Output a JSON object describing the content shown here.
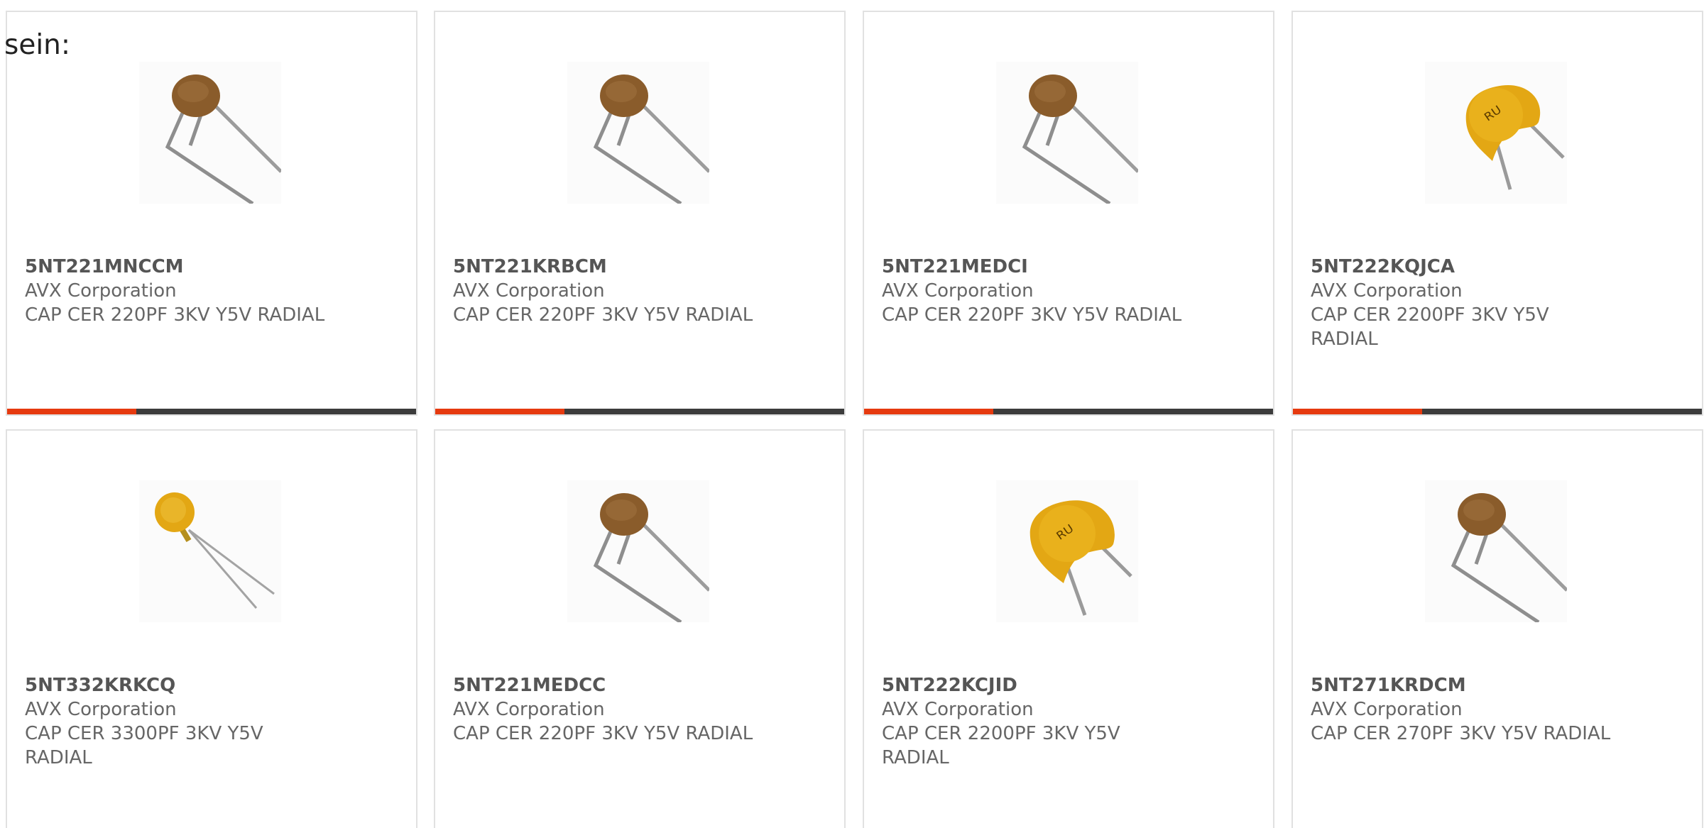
{
  "intro_text": "sein:",
  "colors": {
    "accent": "#e63a0f",
    "bar_dark": "#3c3c3c",
    "card_border": "#e1e1e1"
  },
  "products": [
    {
      "part_number": "5NT221MNCCM",
      "manufacturer": "AVX Corporation",
      "description": "CAP CER 220PF 3KV Y5V RADIAL",
      "image_icon": "brown-disc-capacitor-icon"
    },
    {
      "part_number": "5NT221KRBCM",
      "manufacturer": "AVX Corporation",
      "description": "CAP CER 220PF 3KV Y5V RADIAL",
      "image_icon": "brown-disc-capacitor-icon"
    },
    {
      "part_number": "5NT221MEDCI",
      "manufacturer": "AVX Corporation",
      "description": "CAP CER 220PF 3KV Y5V RADIAL",
      "image_icon": "brown-disc-capacitor-icon"
    },
    {
      "part_number": "5NT222KQJCA",
      "manufacturer": "AVX Corporation",
      "description": "CAP CER 2200PF 3KV Y5V RADIAL",
      "image_icon": "yellow-disc-capacitor-icon"
    },
    {
      "part_number": "5NT332KRKCQ",
      "manufacturer": "AVX Corporation",
      "description": "CAP CER 3300PF 3KV Y5V RADIAL",
      "image_icon": "small-yellow-disc-capacitor-icon"
    },
    {
      "part_number": "5NT221MEDCC",
      "manufacturer": "AVX Corporation",
      "description": "CAP CER 220PF 3KV Y5V RADIAL",
      "image_icon": "brown-disc-capacitor-icon"
    },
    {
      "part_number": "5NT222KCJID",
      "manufacturer": "AVX Corporation",
      "description": "CAP CER 2200PF 3KV Y5V RADIAL",
      "image_icon": "yellow-disc-capacitor-icon"
    },
    {
      "part_number": "5NT271KRDCM",
      "manufacturer": "AVX Corporation",
      "description": "CAP CER 270PF 3KV Y5V RADIAL",
      "image_icon": "brown-disc-capacitor-icon"
    }
  ]
}
